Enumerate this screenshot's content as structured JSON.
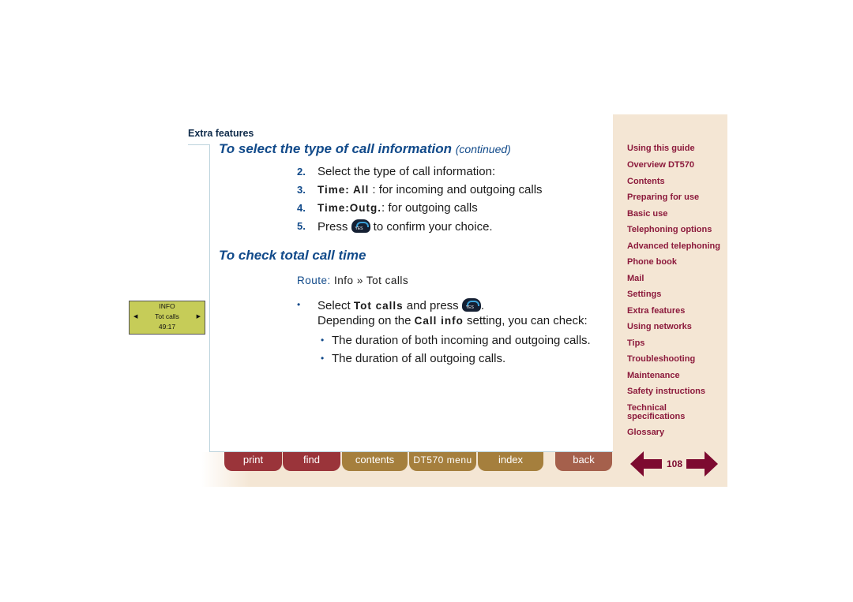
{
  "section": "Extra features",
  "heading1": {
    "title": "To select the type of call information",
    "suffix": "(continued)"
  },
  "steps": [
    {
      "num": "2.",
      "text": "Select the type of call information:"
    },
    {
      "num": "3.",
      "kw": "Time: All",
      "text": " : for incoming and outgoing calls"
    },
    {
      "num": "4.",
      "kw": "Time:Outg.",
      "text": ": for outgoing calls"
    },
    {
      "num": "5.",
      "pre": "Press ",
      "text": " to confirm your choice."
    }
  ],
  "heading2": "To check total call time",
  "route": {
    "label": "Route:",
    "path": "Info » Tot calls"
  },
  "bullet": {
    "pre": "Select ",
    "kw": "Tot calls",
    "post": " and press ",
    "end": ".",
    "line2pre": "Depending on the ",
    "line2kw": "Call info",
    "line2post": " setting, you can check:"
  },
  "subbullets": [
    "The duration of both incoming and outgoing calls.",
    "The duration of all outgoing calls."
  ],
  "lcd": {
    "title": "INFO",
    "item": "Tot calls",
    "value": "49:17"
  },
  "sidebar": [
    "Using this guide",
    "Overview DT570",
    "Contents",
    "Preparing for use",
    "Basic use",
    "Telephoning options",
    "Advanced telephoning",
    "Phone book",
    "Mail",
    "Settings",
    "Extra features",
    "Using networks",
    "Tips",
    "Troubleshooting",
    "Maintenance",
    "Safety instructions",
    "Technical specifications",
    "Glossary"
  ],
  "toolbar": {
    "print": "print",
    "find": "find",
    "contents": "contents",
    "menu": "DT570 menu",
    "index": "index",
    "back": "back"
  },
  "page_number": "108",
  "colors": {
    "accent": "#114a8a",
    "nav": "#8c1a3c",
    "sidebar_bg": "#f4e6d4"
  }
}
